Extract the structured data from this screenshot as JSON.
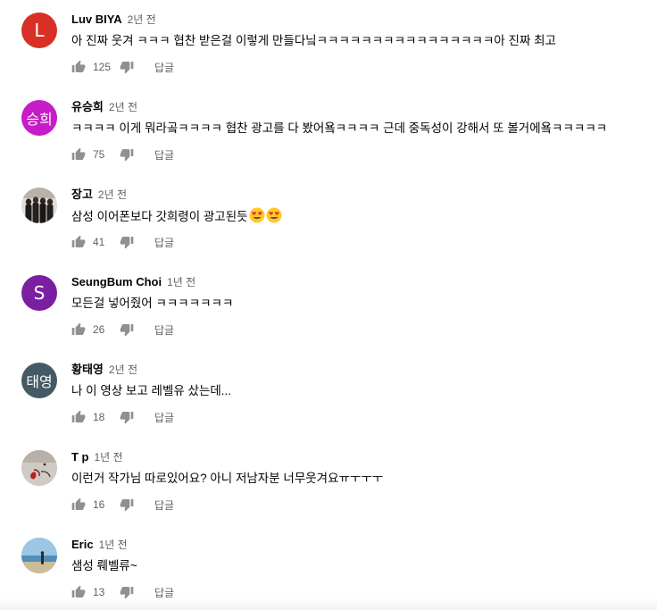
{
  "comments": [
    {
      "author": "Luv BIYA",
      "time": "2년 전",
      "text": "아 진짜 웃겨 ㅋㅋㅋ 협찬 받은걸 이렇게 만들다닠ㅋㅋㅋㅋㅋㅋㅋㅋㅋㅋㅋㅋㅋㅋㅋㅋ아 진짜 최고",
      "likes": "125",
      "reply_label": "답글",
      "avatar": {
        "type": "letter",
        "letter": "L",
        "color": "#d93025"
      }
    },
    {
      "author": "유승희",
      "time": "2년 전",
      "text": "ㅋㅋㅋㅋ 이게 뭐라곸ㅋㅋㅋㅋ 협찬 광고를 다 봤어욬ㅋㅋㅋㅋ 근데 중독성이 강해서 또 볼거에욬ㅋㅋㅋㅋㅋ",
      "likes": "75",
      "reply_label": "답글",
      "avatar": {
        "type": "letter",
        "letter": "승희",
        "color": "#c71cc7"
      }
    },
    {
      "author": "장고",
      "time": "2년 전",
      "text": "삼성 이어폰보다 갓희령이 광고된듯",
      "emojis": [
        "heart-eyes-emoji",
        "heart-eyes-emoji"
      ],
      "likes": "41",
      "reply_label": "답글",
      "avatar": {
        "type": "photo",
        "name": "group-photo"
      }
    },
    {
      "author": "SeungBum Choi",
      "time": "1년 전",
      "text": "모든걸 넣어줬어 ㅋㅋㅋㅋㅋㅋㅋ",
      "likes": "26",
      "reply_label": "답글",
      "avatar": {
        "type": "letter",
        "letter": "S",
        "color": "#7b1fa2"
      }
    },
    {
      "author": "황태영",
      "time": "2년 전",
      "text": "나 이 영상 보고 레벨유 샀는데...",
      "likes": "18",
      "reply_label": "답글",
      "avatar": {
        "type": "letter",
        "letter": "태영",
        "color": "#455a64"
      }
    },
    {
      "author": "T p",
      "time": "1년 전",
      "text": "이런거 작가님 따로있어요?  아니 저남자분 너무웃겨요ㅠㅜㅜㅜ",
      "likes": "16",
      "reply_label": "답글",
      "avatar": {
        "type": "photo",
        "name": "drawing-photo"
      }
    },
    {
      "author": "Eric",
      "time": "1년 전",
      "text": "샘성 뤠벨류~",
      "likes": "13",
      "reply_label": "답글",
      "avatar": {
        "type": "photo",
        "name": "beach-photo"
      }
    }
  ],
  "colors": {
    "author": "#030303",
    "meta": "#606060",
    "icon": "#909090"
  }
}
